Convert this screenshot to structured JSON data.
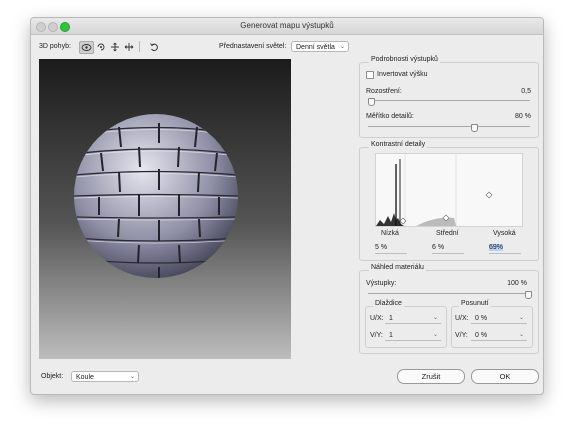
{
  "window": {
    "title": "Generovat mapu výstupků"
  },
  "toolbar": {
    "motion_label": "3D pohyb:",
    "tools": [
      "rotate-3d",
      "roll-3d",
      "pan-3d",
      "slide-3d",
      "reset-view"
    ],
    "preset_label": "Přednastavení světel:",
    "preset_value": "Denní světla"
  },
  "details": {
    "title": "Podrobnosti výstupků",
    "invert_label": "Invertovat výšku",
    "invert_checked": false,
    "blur_label": "Rozostření:",
    "blur_value": "0,5",
    "blur_level": 0.03,
    "scale_label": "Měřítko detailů:",
    "scale_value": "80 %",
    "scale_level": 0.68
  },
  "contrast": {
    "title": "Kontrastní detaily",
    "low_label": "Nízká",
    "mid_label": "Střední",
    "high_label": "Vysoká",
    "low_value": "5 %",
    "mid_value": "6 %",
    "high_value": "69%"
  },
  "material": {
    "title": "Náhled materiálu",
    "bumps_label": "Výstupky:",
    "bumps_value": "100 %",
    "bumps_level": 1.0,
    "tiling_title": "Dlaždice",
    "ux_label": "U/X:",
    "ux_value": "1",
    "vy_label": "V/Y:",
    "vy_value": "1",
    "offset_title": "Posunutí",
    "ox_label": "U/X:",
    "ox_value": "0 %",
    "oy_label": "V/Y:",
    "oy_value": "0 %"
  },
  "footer": {
    "object_label": "Objekt:",
    "object_value": "Koule",
    "cancel_label": "Zrušit",
    "ok_label": "OK"
  }
}
